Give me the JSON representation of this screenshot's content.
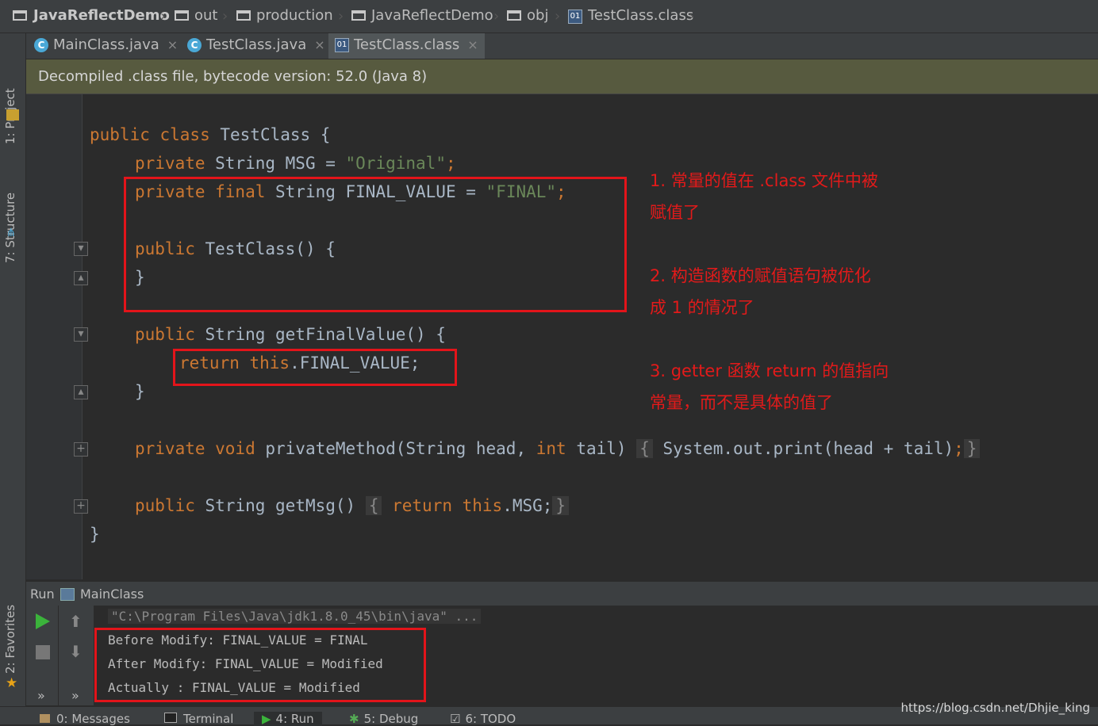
{
  "breadcrumb": [
    "JavaReflectDemo",
    "out",
    "production",
    "JavaReflectDemo",
    "obj",
    "TestClass.class"
  ],
  "left_tools": {
    "project": "1: Project",
    "structure": "7: Structure",
    "favorites": "2: Favorites"
  },
  "tabs": [
    {
      "label": "MainClass.java",
      "close": "×"
    },
    {
      "label": "TestClass.java",
      "close": "×"
    },
    {
      "label": "TestClass.class",
      "close": "×"
    }
  ],
  "banner": "Decompiled .class file, bytecode version: 52.0 (Java 8)",
  "code": {
    "l1": {
      "kw": "public class ",
      "rest": "TestClass {"
    },
    "l2": {
      "kw": "private ",
      "type": "String MSG = ",
      "str": "\"Original\"",
      "end": ";"
    },
    "l3": {
      "kw": "private final ",
      "type": "String FINAL_VALUE = ",
      "str": "\"FINAL\"",
      "end": ";"
    },
    "l4": {
      "kw": "public ",
      "rest": "TestClass() {"
    },
    "l5": "}",
    "l6": {
      "kw": "public ",
      "rest": "String getFinalValue() {"
    },
    "l7": {
      "kw": "return this",
      "rest": ".FINAL_VALUE;"
    },
    "l8": "}",
    "l9": {
      "kw": "private void ",
      "rest": "privateMethod(String head, ",
      "kw2": "int ",
      "rest2": "tail) ",
      "fold1": "{",
      "body": " System.out.print(head + tail)",
      "semi": ";",
      "fold2": "}"
    },
    "l10": {
      "kw": "public ",
      "rest": "String getMsg() ",
      "fold1": "{",
      "body": " ",
      "kw2": "return this",
      "rest2": ".MSG;",
      "fold2": "}"
    },
    "l11": "}"
  },
  "notes": {
    "n1a": "1. 常量的值在 .class 文件中被",
    "n1b": "赋值了",
    "n2a": "2. 构造函数的赋值语句被优化",
    "n2b": "成 1 的情况了",
    "n3a": "3. getter 函数 return 的值指向",
    "n3b": "常量，而不是具体的值了"
  },
  "run": {
    "label": "Run",
    "config": "MainClass"
  },
  "console": [
    "\"C:\\Program Files\\Java\\jdk1.8.0_45\\bin\\java\" ...",
    "Before Modify: FINAL_VALUE = FINAL",
    "After Modify: FINAL_VALUE = Modified",
    "Actually : FINAL_VALUE = Modified"
  ],
  "bottom_tabs": [
    "0: Messages",
    "Terminal",
    "4: Run",
    "5: Debug",
    "6: TODO"
  ],
  "watermark": "https://blog.csdn.net/Dhjie_king",
  "colors": {
    "keyword": "#cc7832",
    "string": "#6a8759",
    "annotation": "#e31a1a"
  }
}
